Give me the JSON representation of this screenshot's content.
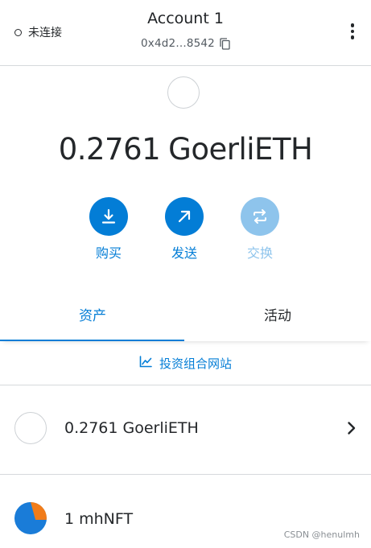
{
  "header": {
    "connection_status": "未连接",
    "account_name": "Account 1",
    "address_short": "0x4d2...8542"
  },
  "balance": {
    "amount": "0.2761",
    "currency": "GoerliETH"
  },
  "actions": [
    {
      "label": "购买",
      "icon": "download-icon",
      "enabled": true
    },
    {
      "label": "发送",
      "icon": "arrow-up-right-icon",
      "enabled": true
    },
    {
      "label": "交换",
      "icon": "swap-icon",
      "enabled": false
    }
  ],
  "tabs": [
    {
      "label": "资产",
      "active": true
    },
    {
      "label": "活动",
      "active": false
    }
  ],
  "portfolio_link": {
    "label": "投资组合网站",
    "icon": "chart-icon"
  },
  "assets": [
    {
      "label": "0.2761 GoerliETH"
    },
    {
      "label": "1 mhNFT"
    }
  ],
  "watermark": "CSDN @henulmh",
  "colors": {
    "accent": "#037dd6",
    "accent_disabled": "#8ec4ec",
    "text": "#24272a",
    "divider": "#d6d9dc"
  }
}
